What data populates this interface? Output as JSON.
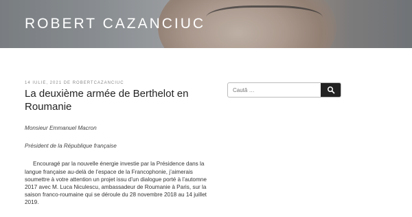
{
  "site": {
    "title": "ROBERT CAZANCIUC"
  },
  "post": {
    "meta": "14 IULIE, 2021 DE ROBERTCAZANCIUC",
    "title": "La deuxième armée de Berthelot en Roumanie",
    "paragraphs": {
      "p1": "Monsieur Emmanuel Macron",
      "p2": "Président de la République française",
      "p3": "Encouragé par la nouvelle énergie investie par la Présidence dans la langue française  au-delà de l’espace de la Francophonie, j’aimerais soumettre à votre attention un projet issu d’un dialogue porté à l’automne 2017 avec M. Luca Niculescu, ambassadeur de Roumanie à Paris, sur la saison franco-roumaine qui se déroule du 28 novembre 2018 au 14 juillet 2019."
    }
  },
  "search": {
    "placeholder": "Caută …",
    "icon": "search-icon",
    "button_color": "#222222"
  }
}
